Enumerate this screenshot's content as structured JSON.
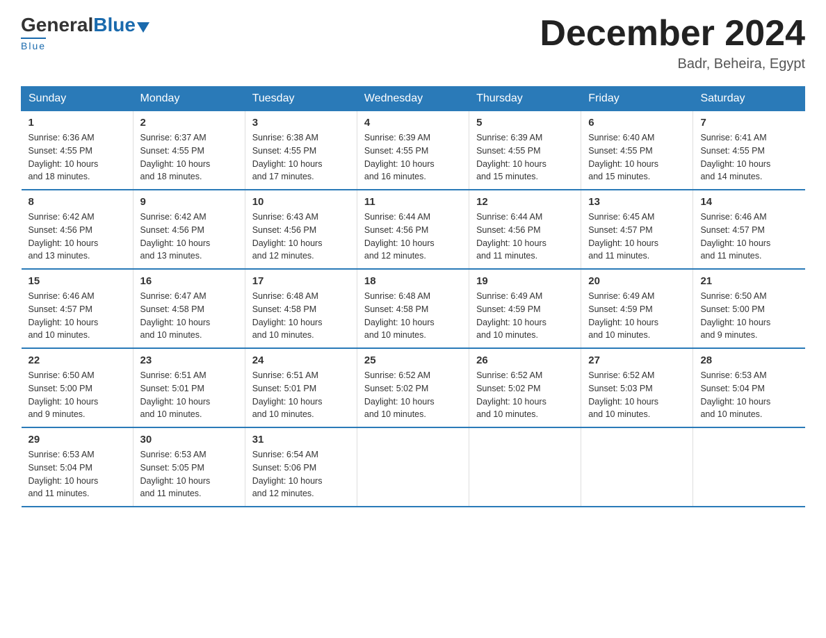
{
  "header": {
    "logo_general": "General",
    "logo_blue": "Blue",
    "logo_underline": "Blue",
    "month_title": "December 2024",
    "location": "Badr, Beheira, Egypt"
  },
  "days_of_week": [
    "Sunday",
    "Monday",
    "Tuesday",
    "Wednesday",
    "Thursday",
    "Friday",
    "Saturday"
  ],
  "weeks": [
    [
      {
        "day": "1",
        "sunrise": "6:36 AM",
        "sunset": "4:55 PM",
        "daylight": "10 hours and 18 minutes."
      },
      {
        "day": "2",
        "sunrise": "6:37 AM",
        "sunset": "4:55 PM",
        "daylight": "10 hours and 18 minutes."
      },
      {
        "day": "3",
        "sunrise": "6:38 AM",
        "sunset": "4:55 PM",
        "daylight": "10 hours and 17 minutes."
      },
      {
        "day": "4",
        "sunrise": "6:39 AM",
        "sunset": "4:55 PM",
        "daylight": "10 hours and 16 minutes."
      },
      {
        "day": "5",
        "sunrise": "6:39 AM",
        "sunset": "4:55 PM",
        "daylight": "10 hours and 15 minutes."
      },
      {
        "day": "6",
        "sunrise": "6:40 AM",
        "sunset": "4:55 PM",
        "daylight": "10 hours and 15 minutes."
      },
      {
        "day": "7",
        "sunrise": "6:41 AM",
        "sunset": "4:55 PM",
        "daylight": "10 hours and 14 minutes."
      }
    ],
    [
      {
        "day": "8",
        "sunrise": "6:42 AM",
        "sunset": "4:56 PM",
        "daylight": "10 hours and 13 minutes."
      },
      {
        "day": "9",
        "sunrise": "6:42 AM",
        "sunset": "4:56 PM",
        "daylight": "10 hours and 13 minutes."
      },
      {
        "day": "10",
        "sunrise": "6:43 AM",
        "sunset": "4:56 PM",
        "daylight": "10 hours and 12 minutes."
      },
      {
        "day": "11",
        "sunrise": "6:44 AM",
        "sunset": "4:56 PM",
        "daylight": "10 hours and 12 minutes."
      },
      {
        "day": "12",
        "sunrise": "6:44 AM",
        "sunset": "4:56 PM",
        "daylight": "10 hours and 11 minutes."
      },
      {
        "day": "13",
        "sunrise": "6:45 AM",
        "sunset": "4:57 PM",
        "daylight": "10 hours and 11 minutes."
      },
      {
        "day": "14",
        "sunrise": "6:46 AM",
        "sunset": "4:57 PM",
        "daylight": "10 hours and 11 minutes."
      }
    ],
    [
      {
        "day": "15",
        "sunrise": "6:46 AM",
        "sunset": "4:57 PM",
        "daylight": "10 hours and 10 minutes."
      },
      {
        "day": "16",
        "sunrise": "6:47 AM",
        "sunset": "4:58 PM",
        "daylight": "10 hours and 10 minutes."
      },
      {
        "day": "17",
        "sunrise": "6:48 AM",
        "sunset": "4:58 PM",
        "daylight": "10 hours and 10 minutes."
      },
      {
        "day": "18",
        "sunrise": "6:48 AM",
        "sunset": "4:58 PM",
        "daylight": "10 hours and 10 minutes."
      },
      {
        "day": "19",
        "sunrise": "6:49 AM",
        "sunset": "4:59 PM",
        "daylight": "10 hours and 10 minutes."
      },
      {
        "day": "20",
        "sunrise": "6:49 AM",
        "sunset": "4:59 PM",
        "daylight": "10 hours and 10 minutes."
      },
      {
        "day": "21",
        "sunrise": "6:50 AM",
        "sunset": "5:00 PM",
        "daylight": "10 hours and 9 minutes."
      }
    ],
    [
      {
        "day": "22",
        "sunrise": "6:50 AM",
        "sunset": "5:00 PM",
        "daylight": "10 hours and 9 minutes."
      },
      {
        "day": "23",
        "sunrise": "6:51 AM",
        "sunset": "5:01 PM",
        "daylight": "10 hours and 10 minutes."
      },
      {
        "day": "24",
        "sunrise": "6:51 AM",
        "sunset": "5:01 PM",
        "daylight": "10 hours and 10 minutes."
      },
      {
        "day": "25",
        "sunrise": "6:52 AM",
        "sunset": "5:02 PM",
        "daylight": "10 hours and 10 minutes."
      },
      {
        "day": "26",
        "sunrise": "6:52 AM",
        "sunset": "5:02 PM",
        "daylight": "10 hours and 10 minutes."
      },
      {
        "day": "27",
        "sunrise": "6:52 AM",
        "sunset": "5:03 PM",
        "daylight": "10 hours and 10 minutes."
      },
      {
        "day": "28",
        "sunrise": "6:53 AM",
        "sunset": "5:04 PM",
        "daylight": "10 hours and 10 minutes."
      }
    ],
    [
      {
        "day": "29",
        "sunrise": "6:53 AM",
        "sunset": "5:04 PM",
        "daylight": "10 hours and 11 minutes."
      },
      {
        "day": "30",
        "sunrise": "6:53 AM",
        "sunset": "5:05 PM",
        "daylight": "10 hours and 11 minutes."
      },
      {
        "day": "31",
        "sunrise": "6:54 AM",
        "sunset": "5:06 PM",
        "daylight": "10 hours and 12 minutes."
      },
      null,
      null,
      null,
      null
    ]
  ],
  "labels": {
    "sunrise": "Sunrise:",
    "sunset": "Sunset:",
    "daylight": "Daylight:"
  }
}
